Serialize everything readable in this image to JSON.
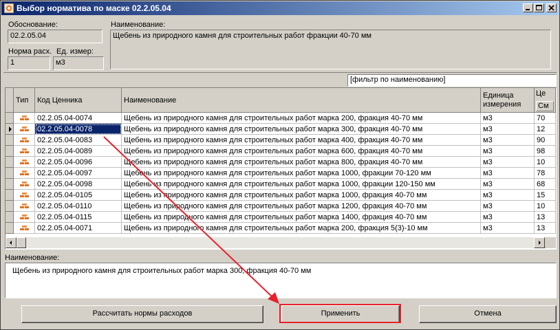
{
  "window": {
    "title": "Выбор норматива по маске 02.2.05.04"
  },
  "form": {
    "osnovanie_label": "Обоснование:",
    "osnovanie_value": "02.2.05.04",
    "naimenovanie_label": "Наименование:",
    "naimenovanie_value": "Щебень из природного камня для строительных работ фракции 40-70 мм",
    "norma_label": "Норма расх.",
    "norma_value": "1",
    "ed_label": "Ед. измер:",
    "ed_value": "м3"
  },
  "filter": {
    "value": "[фильтр по наименованию]"
  },
  "grid": {
    "columns": {
      "tip": "Тип",
      "kod": "Код Ценника",
      "name": "Наименование",
      "unit_line1": "Единица",
      "unit_line2": "измерения",
      "price_top": "Це",
      "price_sub": "См"
    },
    "rows": [
      {
        "kod": "02.2.05.04-0074",
        "name": "Щебень из природного камня для строительных работ марка 200, фракция 40-70 мм",
        "unit": "м3",
        "price": "70"
      },
      {
        "kod": "02.2.05.04-0078",
        "name": "Щебень из природного камня для строительных работ марка 300, фракция 40-70 мм",
        "unit": "м3",
        "price": "12"
      },
      {
        "kod": "02.2.05.04-0083",
        "name": "Щебень из природного камня для строительных работ марка 400, фракция 40-70 мм",
        "unit": "м3",
        "price": "90"
      },
      {
        "kod": "02.2.05.04-0089",
        "name": "Щебень из природного камня для строительных работ марка 600, фракция 40-70 мм",
        "unit": "м3",
        "price": "98"
      },
      {
        "kod": "02.2.05.04-0096",
        "name": "Щебень из природного камня для строительных работ марка 800, фракция 40-70 мм",
        "unit": "м3",
        "price": "10"
      },
      {
        "kod": "02.2.05.04-0097",
        "name": "Щебень из природного камня для строительных работ марка 1000, фракции 70-120 мм",
        "unit": "м3",
        "price": "78"
      },
      {
        "kod": "02.2.05.04-0098",
        "name": "Щебень из природного камня для строительных работ марка 1000, фракции 120-150 мм",
        "unit": "м3",
        "price": "68"
      },
      {
        "kod": "02.2.05.04-0105",
        "name": "Щебень из природного камня для строительных работ марка 1000, фракция 40-70 мм",
        "unit": "м3",
        "price": "15"
      },
      {
        "kod": "02.2.05.04-0110",
        "name": "Щебень из природного камня для строительных работ марка 1200, фракция 40-70 мм",
        "unit": "м3",
        "price": "10"
      },
      {
        "kod": "02.2.05.04-0115",
        "name": "Щебень из природного камня для строительных работ марка 1400, фракция 40-70 мм",
        "unit": "м3",
        "price": "13"
      },
      {
        "kod": "02.2.05.04-0071",
        "name": "Щебень из природного камня для строительных работ марка 200, фракция 5(3)-10 мм",
        "unit": "м3",
        "price": "13"
      }
    ],
    "selected_index": 1
  },
  "detail": {
    "label": "Наименование:",
    "value": "Щебень из природного камня для строительных работ марка 300, фракция 40-70 мм"
  },
  "buttons": {
    "calc": "Рассчитать нормы расходов",
    "apply": "Применить",
    "cancel": "Отмена"
  },
  "colors": {
    "title_start": "#0a246a",
    "title_end": "#a6caf0",
    "selection": "#0a246a",
    "annotation": "#e8202a",
    "brick_icon": "#e07020"
  },
  "icons": {
    "app": "app-icon",
    "row_type": "brick-icon",
    "annotation": "red-arrow"
  }
}
